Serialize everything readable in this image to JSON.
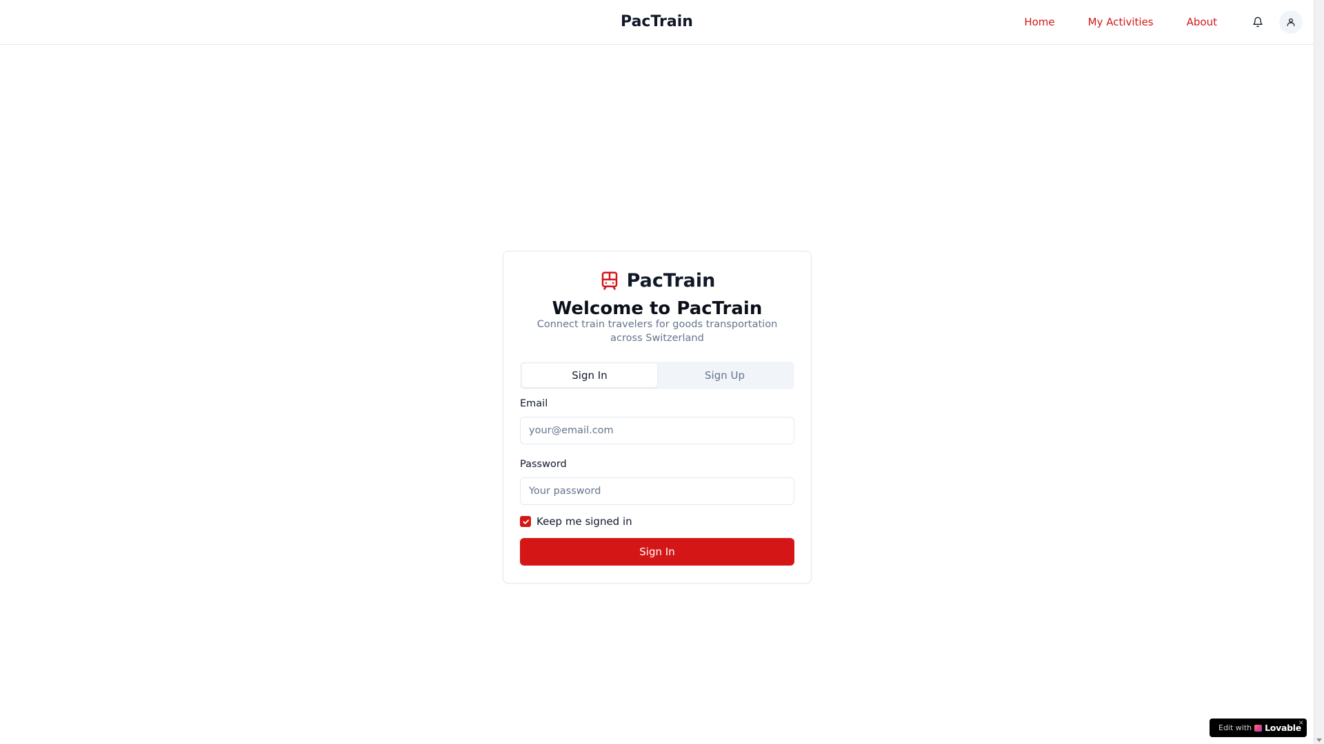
{
  "header": {
    "brand": "PacTrain",
    "nav": {
      "home": "Home",
      "activities": "My Activities",
      "about": "About"
    },
    "icons": {
      "notifications": "bell-icon",
      "profile": "user-icon"
    }
  },
  "card": {
    "app_name": "PacTrain",
    "logo_icon": "train-icon",
    "title": "Welcome to PacTrain",
    "subtitle": "Connect train travelers for goods transportation across Switzerland",
    "tabs": [
      "Sign In",
      "Sign Up"
    ],
    "active_tab": "Sign In",
    "email": {
      "label": "Email",
      "placeholder": "your@email.com",
      "value": ""
    },
    "password": {
      "label": "Password",
      "placeholder": "Your password",
      "value": ""
    },
    "keep_signed_in": {
      "label": "Keep me signed in",
      "checked": true
    },
    "submit_label": "Sign In"
  },
  "badge": {
    "prefix": "Edit with",
    "brand": "Lovable",
    "close": "×"
  },
  "colors": {
    "accent": "#d41616",
    "muted_text": "#64748b",
    "border": "#e2e8f0",
    "tab_bg": "#f1f5f9"
  }
}
